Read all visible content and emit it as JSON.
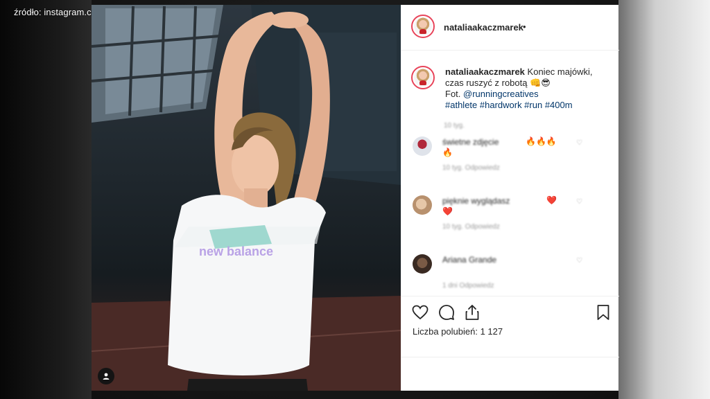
{
  "source_label": "źródło: instagram.com/nataliakaczmarek",
  "photo": {
    "shirt_text": "new balance"
  },
  "post": {
    "username": "nataliaakaczmarek",
    "dot": "•",
    "caption": {
      "username": "nataliaakaczmarek",
      "line1": "Koniec majówki,",
      "line2": "czas ruszyć z robotą",
      "line2_emoji": "👊😎",
      "line3_prefix": "Fot.",
      "mention": "@runningcreatives",
      "hashtags": "#athlete #hardwork #run #400m",
      "time": "10 tyg."
    },
    "comments": [
      {
        "text": "świetne zdjęcie",
        "emoji": "🔥🔥🔥",
        "emoji2": "🔥",
        "meta": "10 tyg.   Odpowiedz"
      },
      {
        "text": "pięknie wyglądasz",
        "emoji": "❤️",
        "emoji2": "❤️",
        "meta": "10 tyg.   Odpowiedz"
      },
      {
        "text": "Ariana Grande",
        "emoji": "",
        "emoji2": "",
        "meta": "1 dni   Odpowiedz"
      }
    ],
    "likes": "Liczba polubień: 1 127"
  },
  "icons": {
    "heart": "heart-icon",
    "comment": "comment-icon",
    "share": "share-icon",
    "bookmark": "bookmark-icon",
    "user": "user-icon"
  },
  "colors": {
    "accent_ring": "#e8445a",
    "link": "#003569"
  }
}
